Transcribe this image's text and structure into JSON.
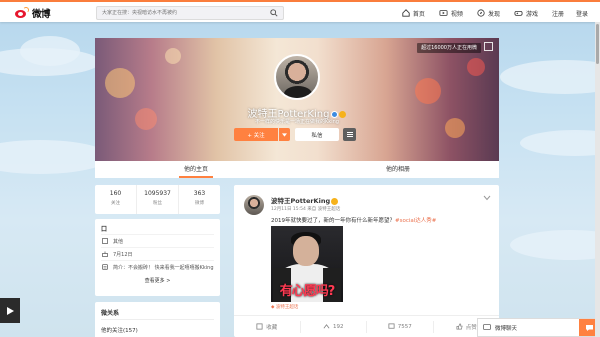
{
  "nav": {
    "logo_text": "微博",
    "search_placeholder": "大家正在搜：央视暗访水不再被约",
    "links": [
      "首页",
      "视频",
      "发现",
      "游戏"
    ],
    "register": "注册",
    "login": "登录"
  },
  "cover": {
    "badge": "超过16000万人正在用微",
    "name": "波特王PotterKing",
    "bio": "不一样的快乐是一场正在做我的Kking",
    "follow_label": "+ 关注",
    "message_label": "私信"
  },
  "tabs": [
    "他的主页",
    "他的相册"
  ],
  "stats": [
    {
      "num": "160",
      "label": "关注"
    },
    {
      "num": "1095937",
      "label": "粉丝"
    },
    {
      "num": "363",
      "label": "微博"
    }
  ],
  "info": {
    "title": "口",
    "rows": [
      "其他",
      "7月12日",
      "简介：不会搬砖！ 快来看我一起嘻嘻搬Kking"
    ],
    "more": "查看更多 >"
  },
  "relations": {
    "title": "微关系",
    "follows": "他的关注(157)"
  },
  "post": {
    "name": "波特王PotterKing",
    "meta": "12月11日 15:54 来自 波特王超话",
    "text_main": "2019年就快要过了，新的一年你有什么新年愿望？",
    "text_tag": "#social达人秀#",
    "image_caption": "有心愿吗?",
    "source": "◆ 波特王超话",
    "actions": {
      "share": "收藏",
      "repost": "192",
      "comment": "7557",
      "like": "点赞"
    }
  },
  "chat": {
    "label": "微博聊天"
  },
  "colors": {
    "accent": "#ff8140",
    "link_orange": "#eb7350",
    "brand_red": "#e6162d"
  }
}
